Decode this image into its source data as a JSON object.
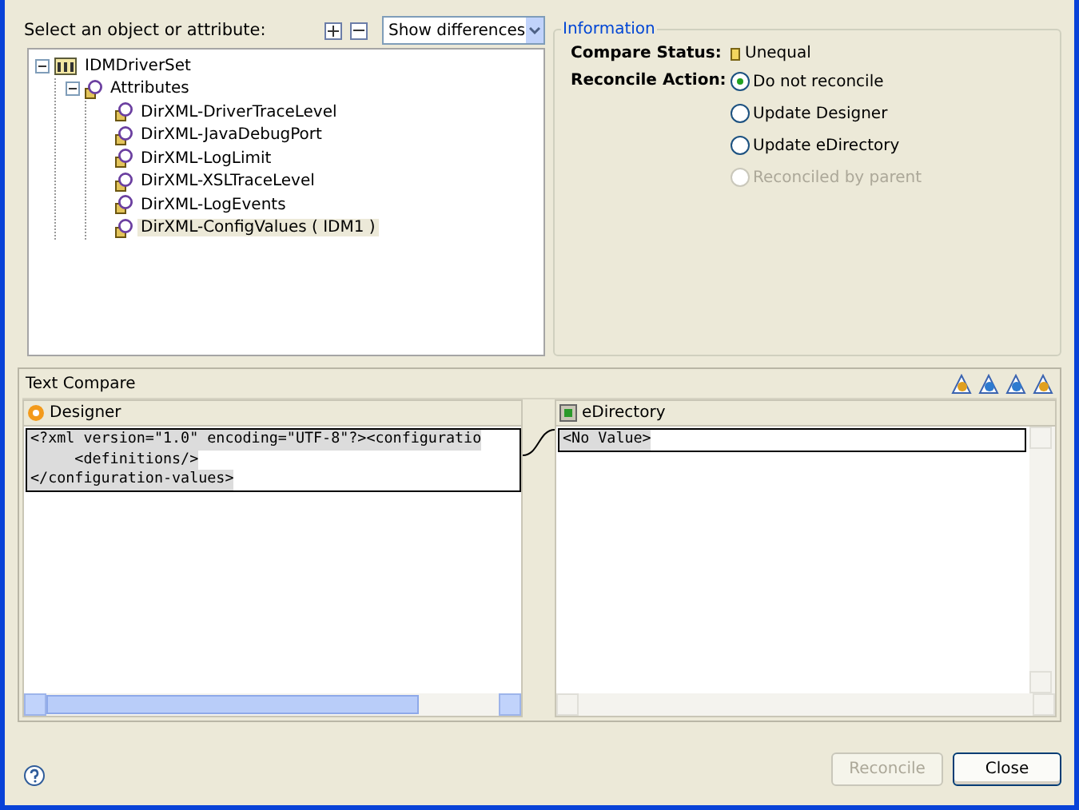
{
  "header": {
    "label": "Select an object or attribute:",
    "filter": {
      "value": "Show differences"
    }
  },
  "tree": [
    {
      "label": "IDMDriverSet",
      "kind": "driverset",
      "expanded": true,
      "selected": false,
      "children": [
        {
          "label": "Attributes",
          "kind": "attribute",
          "expanded": true,
          "selected": false,
          "children": [
            {
              "label": "DirXML-DriverTraceLevel",
              "kind": "attribute",
              "selected": false
            },
            {
              "label": "DirXML-JavaDebugPort",
              "kind": "attribute",
              "selected": false
            },
            {
              "label": "DirXML-LogLimit",
              "kind": "attribute",
              "selected": false
            },
            {
              "label": "DirXML-XSLTraceLevel",
              "kind": "attribute",
              "selected": false
            },
            {
              "label": "DirXML-LogEvents",
              "kind": "attribute",
              "selected": false
            },
            {
              "label": "DirXML-ConfigValues ( IDM1 )",
              "kind": "attribute",
              "selected": true
            }
          ]
        }
      ]
    }
  ],
  "information": {
    "title": "Information",
    "compare_status": {
      "label": "Compare Status:",
      "value": "Unequal"
    },
    "reconcile_action": {
      "label": "Reconcile Action:",
      "options": [
        {
          "label": "Do not reconcile",
          "selected": true,
          "disabled": false
        },
        {
          "label": "Update Designer",
          "selected": false,
          "disabled": false
        },
        {
          "label": "Update eDirectory",
          "selected": false,
          "disabled": false
        },
        {
          "label": "Reconciled by parent",
          "selected": false,
          "disabled": true
        }
      ]
    }
  },
  "text_compare": {
    "title": "Text Compare",
    "left": {
      "title": "Designer",
      "lines": [
        "<?xml version=\"1.0\" encoding=\"UTF-8\"?><configuratio",
        "     <definitions/>",
        "</configuration-values>"
      ]
    },
    "right": {
      "title": "eDirectory",
      "lines": [
        "<No Value>"
      ]
    }
  },
  "buttons": [
    {
      "label": "Reconcile",
      "disabled": true
    },
    {
      "label": "Close",
      "disabled": false
    }
  ]
}
